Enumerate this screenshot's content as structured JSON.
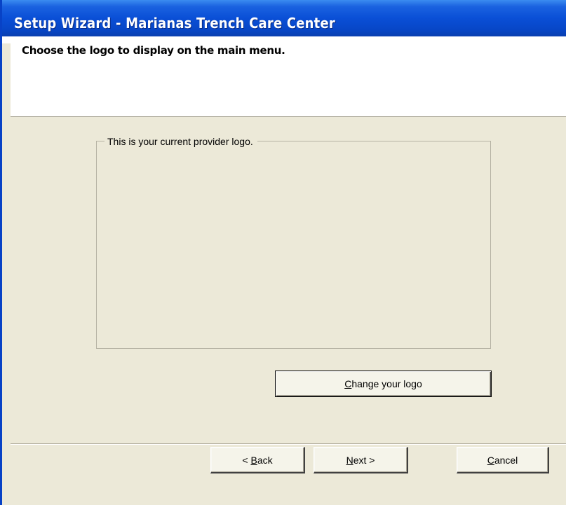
{
  "window": {
    "title": "Setup Wizard - Marianas Trench Care Center"
  },
  "header": {
    "caption": "Choose the logo to display on the main menu."
  },
  "logo_group": {
    "legend": "This is your current provider logo."
  },
  "buttons": {
    "change_logo": {
      "mnemonic": "C",
      "rest": "hange your logo"
    },
    "back": {
      "prefix": "< ",
      "mnemonic": "B",
      "rest": "ack"
    },
    "next": {
      "mnemonic": "N",
      "rest": "ext >"
    },
    "cancel": {
      "mnemonic": "C",
      "rest": "ancel"
    }
  },
  "colors": {
    "title_bar": "#0a4fd6",
    "dialog_background": "#ece9d8",
    "header_background": "#ffffff"
  }
}
